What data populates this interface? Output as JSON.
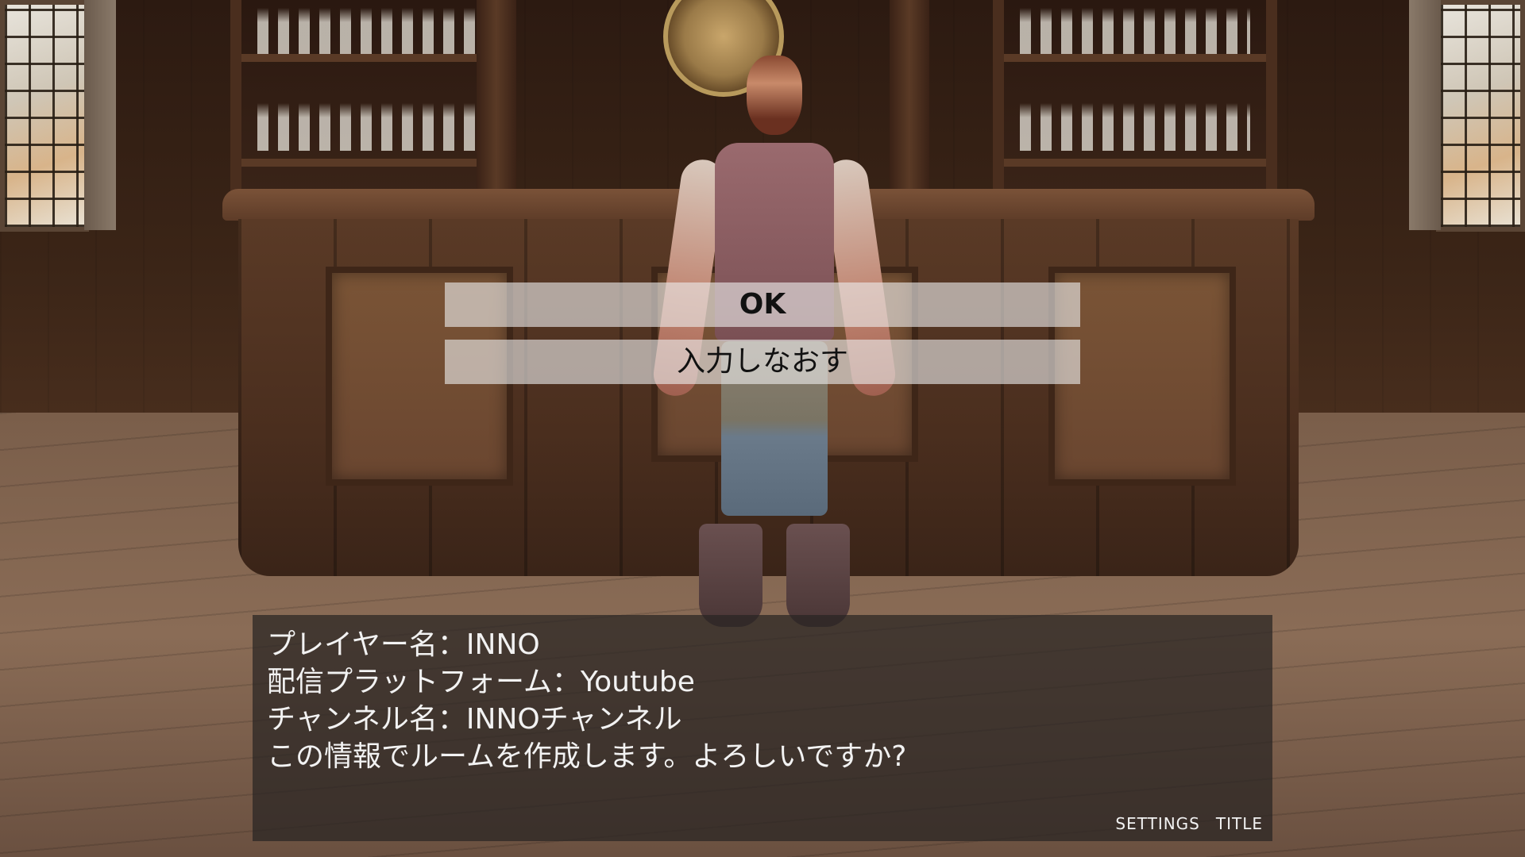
{
  "choices": {
    "ok_label": "OK",
    "retry_label": "入力しなおす"
  },
  "dialog": {
    "lines": [
      "プレイヤー名：INNO",
      "配信プラットフォーム：Youtube",
      "チャンネル名：INNOチャンネル",
      "この情報でルームを作成します。よろしいですか?"
    ]
  },
  "menu": {
    "settings_label": "SETTINGS",
    "title_label": "TITLE"
  }
}
